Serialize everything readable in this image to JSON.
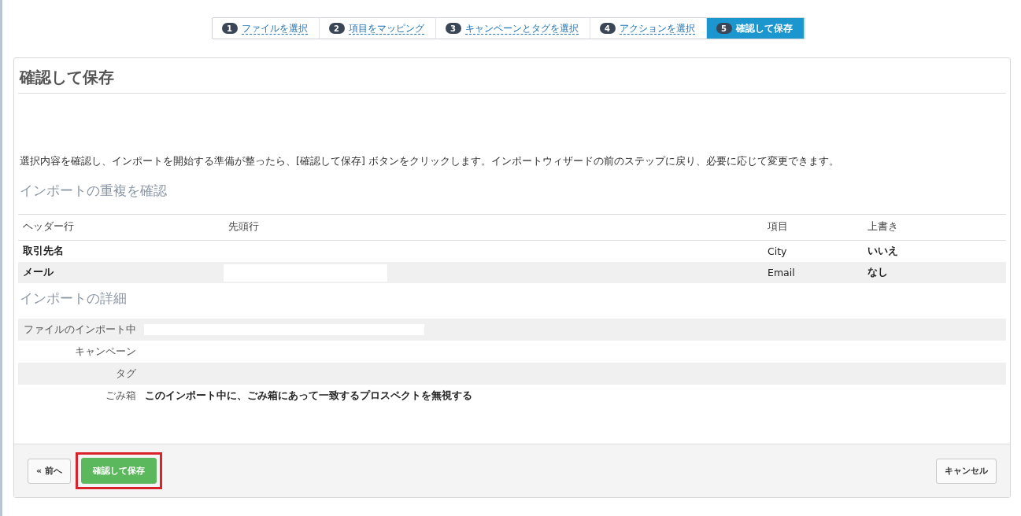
{
  "steps": [
    {
      "number": "1",
      "label": "ファイルを選択",
      "selected": false
    },
    {
      "number": "2",
      "label": "項目をマッピング",
      "selected": false
    },
    {
      "number": "3",
      "label": "キャンペーンとタグを選択",
      "selected": false
    },
    {
      "number": "4",
      "label": "アクションを選択",
      "selected": false
    },
    {
      "number": "5",
      "label": "確認して保存",
      "selected": true
    }
  ],
  "title": "確認して保存",
  "description": "選択内容を確認し、インポートを開始する準備が整ったら、[確認して保存] ボタンをクリックします。インポートウィザードの前のステップに戻り、必要に応じて変更できます。",
  "duplicates": {
    "heading": "インポートの重複を確認",
    "columns": [
      "ヘッダー行",
      "先頭行",
      "項目",
      "上書き"
    ],
    "rows": [
      {
        "header": "取引先名",
        "field": "City",
        "overwrite": "いいえ"
      },
      {
        "header": "メール",
        "first_row_redacted": true,
        "field": "Email",
        "overwrite": "なし"
      }
    ]
  },
  "details": {
    "heading": "インポートの詳細",
    "rows": [
      {
        "label": "ファイルのインポート中",
        "value_redacted": true
      },
      {
        "label": "キャンペーン"
      },
      {
        "label": "タグ",
        "value_redacted": false
      },
      {
        "label": "ごみ箱",
        "value": "このインポート中に、ごみ箱にあって一致するプロスペクトを無視する"
      }
    ]
  },
  "footer": {
    "back": "« 前へ",
    "confirm": "確認して保存",
    "confirm_highlighted": true,
    "cancel": "キャンセル"
  }
}
